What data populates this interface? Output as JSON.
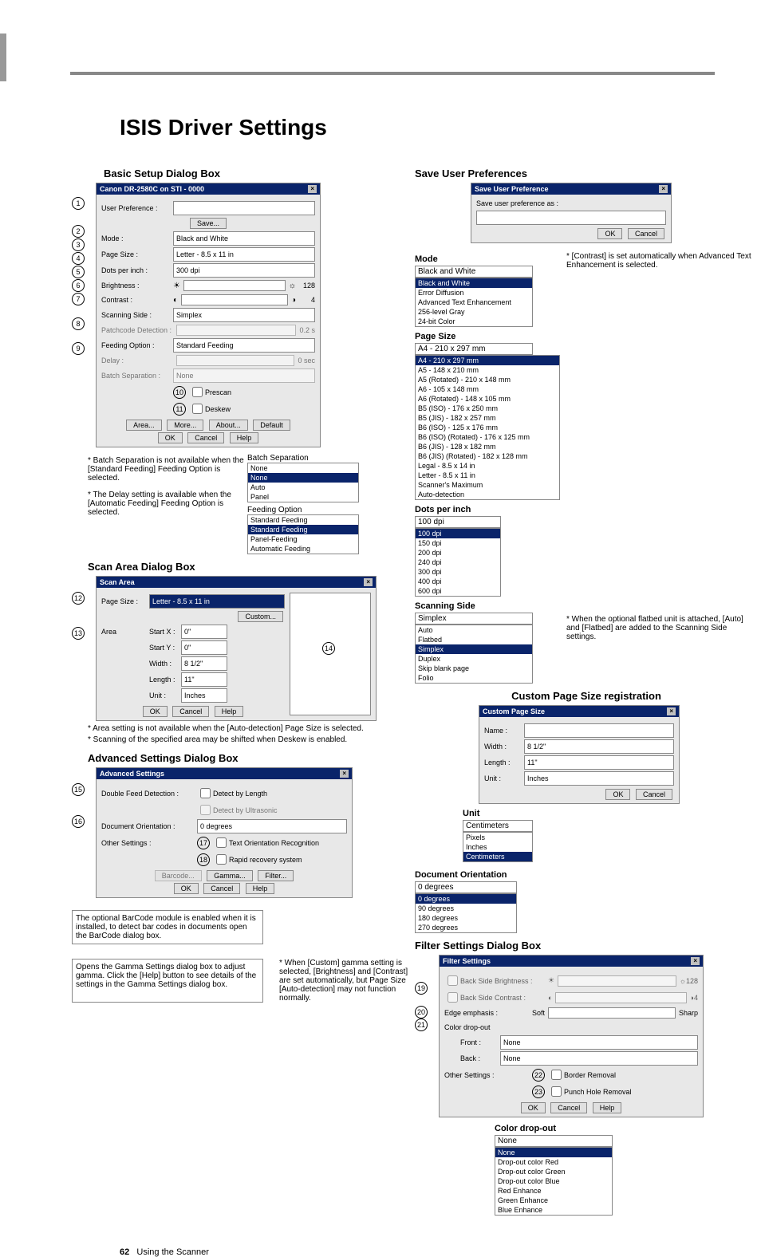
{
  "page_title": "ISIS Driver Settings",
  "footer": {
    "page_num": "62",
    "text": "Using the Scanner"
  },
  "left": {
    "basic_title": "Basic Setup Dialog Box",
    "basic_dlg_title": "Canon DR-2580C on STI - 0000",
    "labels": {
      "user_pref": "User Preference :",
      "save_btn": "Save...",
      "mode": "Mode :",
      "page_size": "Page Size :",
      "dpi": "Dots per inch :",
      "brightness": "Brightness :",
      "contrast": "Contrast :",
      "scanning_side": "Scanning Side :",
      "patch": "Patchcode Detection :",
      "feeding": "Feeding Option :",
      "delay": "Delay :",
      "batch_sep": "Batch Separation :",
      "prescan": "Prescan",
      "deskew": "Deskew"
    },
    "values": {
      "mode": "Black and White",
      "page_size": "Letter - 8.5 x 11 in",
      "dpi": "300 dpi",
      "brightness": "128",
      "contrast": "4",
      "scanning_side": "Simplex",
      "patch_val": "0.2 s",
      "feeding": "Standard Feeding",
      "delay_val": "0 sec",
      "batch": "None"
    },
    "buttons": {
      "area": "Area...",
      "more": "More...",
      "about": "About...",
      "default": "Default",
      "ok": "OK",
      "cancel": "Cancel",
      "help": "Help"
    },
    "note_batch": "* Batch Separation is not available when the [Standard Feeding] Feeding Option is selected.",
    "note_delay": "* The Delay setting is available when the [Automatic Feeding] Feeding Option is selected.",
    "batch_sep_head": "Batch Separation",
    "batch_list": [
      "None",
      "None",
      "Auto",
      "Panel"
    ],
    "feed_opt_head": "Feeding Option",
    "feed_list": [
      "Standard Feeding",
      "Standard Feeding",
      "Panel-Feeding",
      "Automatic Feeding"
    ],
    "scan_area_title": "Scan Area Dialog Box",
    "scan_area_dlg": "Scan Area",
    "scan_area": {
      "page_size_lbl": "Page Size :",
      "page_size_val": "Letter - 8.5 x 11 in",
      "custom_btn": "Custom...",
      "area_lbl": "Area",
      "startx_lbl": "Start X :",
      "startx": "0\"",
      "starty_lbl": "Start Y :",
      "starty": "0\"",
      "width_lbl": "Width :",
      "width": "8 1/2\"",
      "length_lbl": "Length :",
      "length": "11\"",
      "unit_lbl": "Unit :",
      "unit": "Inches"
    },
    "note_area": "* Area setting is not available when the [Auto-detection] Page Size is selected.",
    "note_deskew_scan": "* Scanning of the specified area may be shifted when Deskew is enabled.",
    "adv_title": "Advanced Settings Dialog Box",
    "adv_dlg": "Advanced Settings",
    "adv": {
      "dfd_lbl": "Double Feed Detection :",
      "detect_length": "Detect by Length",
      "detect_ultra": "Detect by Ultrasonic",
      "doc_orient_lbl": "Document Orientation :",
      "doc_orient_val": "0 degrees",
      "other_lbl": "Other Settings :",
      "text_orient": "Text Orientation Recognition",
      "rapid": "Rapid recovery system",
      "barcode_btn": "Barcode...",
      "gamma_btn": "Gamma...",
      "filter_btn": "Filter..."
    },
    "note_barcode": "The optional BarCode module is enabled when it is installed, to detect bar codes in documents open the BarCode dialog box.",
    "note_gamma": "Opens the Gamma Settings dialog box to adjust gamma. Click the [Help] button to see details of the settings in the Gamma Settings dialog box.",
    "note_custom_gamma": "* When [Custom] gamma setting is selected, [Brightness] and [Contrast] are set automatically, but Page Size [Auto-detection] may not function normally."
  },
  "right": {
    "save_pref_title": "Save User Preferences",
    "save_pref_dlg": "Save User Preference",
    "save_pref_lbl": "Save user preference as :",
    "mode_head": "Mode",
    "mode_list": [
      "Black and White",
      "Black and White",
      "Error Diffusion",
      "Advanced Text Enhancement",
      "256-level Gray",
      "24-bit Color"
    ],
    "note_contrast": "* [Contrast] is set automatically when Advanced Text Enhancement is selected.",
    "page_size_head": "Page Size",
    "page_list": [
      "A4 - 210 x 297 mm",
      "A4 - 210 x 297 mm",
      "A5 - 148 x 210 mm",
      "A5 (Rotated) - 210 x 148 mm",
      "A6 - 105 x 148 mm",
      "A6 (Rotated) - 148 x 105 mm",
      "B5 (ISO) - 176 x 250 mm",
      "B5 (JIS) - 182 x 257 mm",
      "B6 (ISO) - 125 x 176 mm",
      "B6 (ISO) (Rotated) - 176 x 125 mm",
      "B6 (JIS) - 128 x 182 mm",
      "B6 (JIS) (Rotated) - 182 x 128 mm",
      "Legal - 8.5 x 14 in",
      "Letter - 8.5 x 11 in",
      "Scanner's Maximum",
      "Auto-detection"
    ],
    "dpi_head": "Dots per inch",
    "dpi_list": [
      "100 dpi",
      "100 dpi",
      "150 dpi",
      "200 dpi",
      "240 dpi",
      "300 dpi",
      "400 dpi",
      "600 dpi"
    ],
    "scan_side_head": "Scanning Side",
    "scan_side_list": [
      "Simplex",
      "Auto",
      "Flatbed",
      "Simplex",
      "Duplex",
      "Skip blank page",
      "Folio"
    ],
    "note_flatbed": "* When the optional flatbed unit is attached, [Auto] and [Flatbed] are added to the Scanning Side settings.",
    "custom_page_head": "Custom Page Size registration",
    "custom_dlg": "Custom Page Size",
    "custom": {
      "name_lbl": "Name :",
      "width_lbl": "Width :",
      "width": "8 1/2\"",
      "length_lbl": "Length :",
      "length": "11\"",
      "unit_lbl": "Unit :",
      "unit": "Inches"
    },
    "unit_head": "Unit",
    "unit_list": [
      "Centimeters",
      "Pixels",
      "Inches",
      "Centimeters"
    ],
    "doc_orient_head": "Document Orientation",
    "doc_orient_list": [
      "0 degrees",
      "0 degrees",
      "90 degrees",
      "180 degrees",
      "270 degrees"
    ],
    "filter_title": "Filter Settings Dialog Box",
    "filter_dlg": "Filter Settings",
    "filter": {
      "back_bright": "Back Side Brightness :",
      "back_contrast": "Back Side Contrast :",
      "edge_lbl": "Edge emphasis :",
      "soft": "Soft",
      "sharp": "Sharp",
      "dropout_lbl": "Color drop-out",
      "front_lbl": "Front :",
      "front_val": "None",
      "back_lbl": "Back :",
      "back_val": "None",
      "other_lbl": "Other Settings :",
      "border": "Border Removal",
      "punch": "Punch Hole Removal",
      "bright_val": "128",
      "contrast_val": "4"
    },
    "dropout_head": "Color drop-out",
    "dropout_list": [
      "None",
      "None",
      "Drop-out color Red",
      "Drop-out color Green",
      "Drop-out color Blue",
      "Red Enhance",
      "Green Enhance",
      "Blue Enhance"
    ]
  }
}
